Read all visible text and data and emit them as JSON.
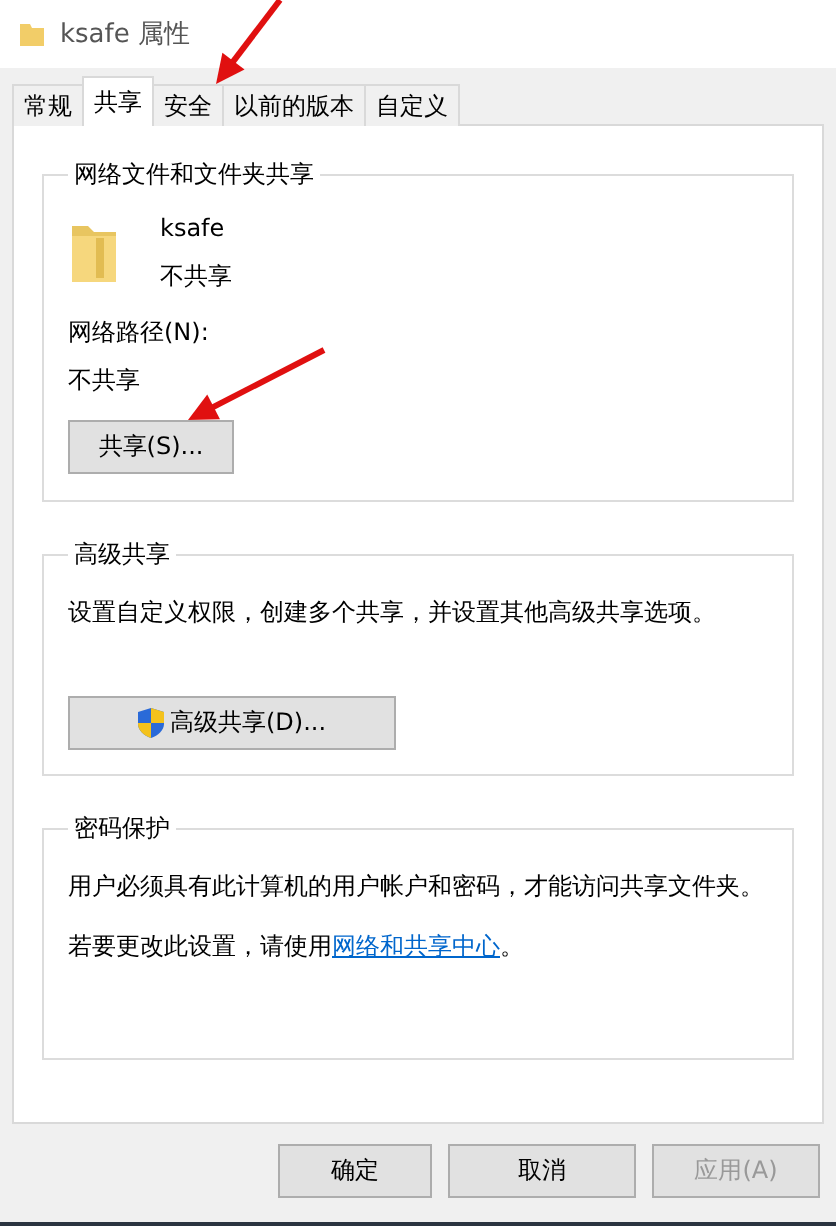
{
  "window": {
    "title": "ksafe 属性"
  },
  "tabs": [
    {
      "label": "常规",
      "selected": false
    },
    {
      "label": "共享",
      "selected": true
    },
    {
      "label": "安全",
      "selected": false
    },
    {
      "label": "以前的版本",
      "selected": false
    },
    {
      "label": "自定义",
      "selected": false
    }
  ],
  "network_sharing": {
    "title": "网络文件和文件夹共享",
    "folder_name": "ksafe",
    "folder_status": "不共享",
    "path_label": "网络路径(N):",
    "path_value": "不共享",
    "button": "共享(S)..."
  },
  "advanced_sharing": {
    "title": "高级共享",
    "description": "设置自定义权限，创建多个共享，并设置其他高级共享选项。",
    "button": "高级共享(D)..."
  },
  "password_protection": {
    "title": "密码保护",
    "description": "用户必须具有此计算机的用户帐户和密码，才能访问共享文件夹。",
    "hint": "若要更改此设置，请使用",
    "link": "网络和共享中心",
    "hint_end": "。"
  },
  "buttons": [
    {
      "label": "确定",
      "disabled": false
    },
    {
      "label": "取消",
      "disabled": false
    },
    {
      "label": "应用(A)",
      "disabled": true
    }
  ]
}
